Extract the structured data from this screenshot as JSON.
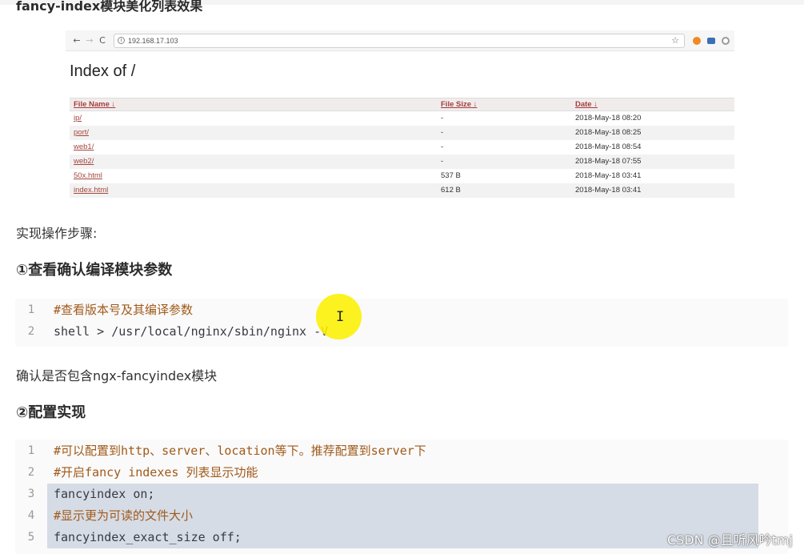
{
  "header": {
    "title": "fancy-index模块美化列表效果"
  },
  "browser": {
    "url": "192.168.17.103",
    "page_title": "Index of /",
    "columns": [
      "File Name  ↓",
      "File Size  ↓",
      "Date  ↓"
    ],
    "rows": [
      {
        "name": "ip/",
        "size": "-",
        "date": "2018-May-18 08:20"
      },
      {
        "name": "port/",
        "size": "-",
        "date": "2018-May-18 08:25"
      },
      {
        "name": "web1/",
        "size": "-",
        "date": "2018-May-18 08:54"
      },
      {
        "name": "web2/",
        "size": "-",
        "date": "2018-May-18 07:55"
      },
      {
        "name": "50x.html",
        "size": "537 B",
        "date": "2018-May-18 03:41"
      },
      {
        "name": "index.html",
        "size": "612 B",
        "date": "2018-May-18 03:41"
      }
    ]
  },
  "article": {
    "steps_label": "实现操作步骤:",
    "section1": "①查看确认编译模块参数",
    "code1": [
      {
        "no": "1",
        "text": "#查看版本号及其编译参数"
      },
      {
        "no": "2",
        "text": "shell > /usr/local/nginx/sbin/nginx -V"
      }
    ],
    "para1": "确认是否包含ngx-fancyindex模块",
    "section2": "②配置实现",
    "code2": [
      {
        "no": "1",
        "text": "#可以配置到http、server、location等下。推荐配置到server下"
      },
      {
        "no": "2",
        "text": "#开启fancy indexes 列表显示功能"
      },
      {
        "no": "3",
        "text": "fancyindex on;"
      },
      {
        "no": "4",
        "text": "#显示更为可读的文件大小"
      },
      {
        "no": "5",
        "text": "fancyindex_exact_size off;"
      }
    ]
  },
  "cursor": {
    "glyph": "I"
  },
  "watermark": "CSDN @且听风吟tmj",
  "colors": {
    "link": "#a5463d",
    "highlight": "#d6dce6",
    "cursor_highlight": "#faf000"
  }
}
